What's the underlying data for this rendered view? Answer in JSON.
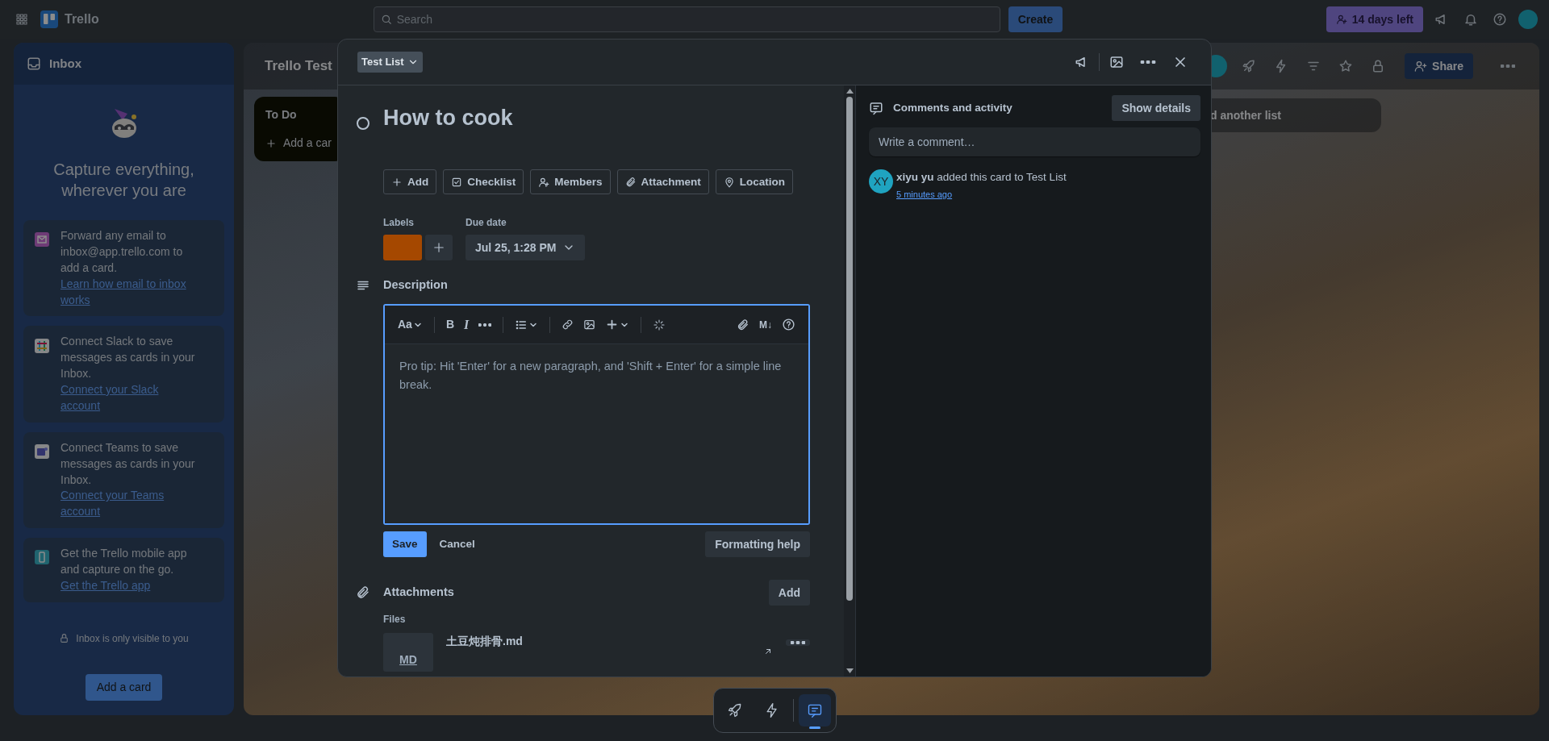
{
  "top_bar": {
    "app_name": "Trello",
    "search": {
      "placeholder": "Search"
    },
    "create_button": "Create",
    "trial_badge": "14 days left"
  },
  "inbox": {
    "title": "Inbox",
    "heading": "Capture everything, wherever you are",
    "cards": [
      {
        "kind": "email",
        "text": "Forward any email to inbox@app.trello.com to add a card.",
        "link": "Learn how email to inbox works"
      },
      {
        "kind": "slack",
        "text": "Connect Slack to save messages as cards in your Inbox.",
        "link": "Connect your Slack account"
      },
      {
        "kind": "teams",
        "text": "Connect Teams to save messages as cards in your Inbox.",
        "link": "Connect your Teams account"
      },
      {
        "kind": "mobile",
        "text": "Get the Trello mobile app and capture on the go.",
        "link": "Get the Trello app"
      }
    ],
    "privacy_note": "Inbox is only visible to you",
    "add_button": "Add a card"
  },
  "board": {
    "title": "Trello Test",
    "lists": [
      {
        "title": "To Do",
        "add_card": "Add a car"
      }
    ],
    "add_list": "d another list",
    "share_button": "Share"
  },
  "card": {
    "list_button": "Test List",
    "title": "How to cook",
    "completed": false,
    "actions": [
      {
        "kind": "add",
        "label": "Add"
      },
      {
        "kind": "checklist",
        "label": "Checklist"
      },
      {
        "kind": "members",
        "label": "Members"
      },
      {
        "kind": "attachment",
        "label": "Attachment"
      },
      {
        "kind": "location",
        "label": "Location"
      }
    ],
    "labels_heading": "Labels",
    "labels": [
      {
        "color": "#a54800"
      }
    ],
    "due_heading": "Due date",
    "due_date": "Jul 25, 1:28 PM",
    "description_heading": "Description",
    "editor": {
      "text_style": "Aa",
      "bold": "B",
      "italic": "I",
      "markdown": "M↓",
      "placeholder": "Pro tip: Hit 'Enter' for a new paragraph, and 'Shift + Enter' for a simple line break."
    },
    "save_button": "Save",
    "cancel_button": "Cancel",
    "help_button": "Formatting help",
    "attachments_heading": "Attachments",
    "attachments_add": "Add",
    "files_heading": "Files",
    "files": [
      {
        "thumb": "MD",
        "name": "土豆炖排骨.md"
      }
    ]
  },
  "activity": {
    "heading": "Comments and activity",
    "show_details": "Show details",
    "comment": {
      "placeholder": "Write a comment…"
    },
    "entries": [
      {
        "initials": "XY",
        "text": "**xiyu yu** added this card to Test List",
        "time": "5 minutes ago"
      }
    ]
  },
  "dock": [
    {
      "kind": "rocket",
      "selected": false
    },
    {
      "kind": "bolt",
      "selected": false
    },
    {
      "kind": "comment",
      "selected": true
    }
  ]
}
